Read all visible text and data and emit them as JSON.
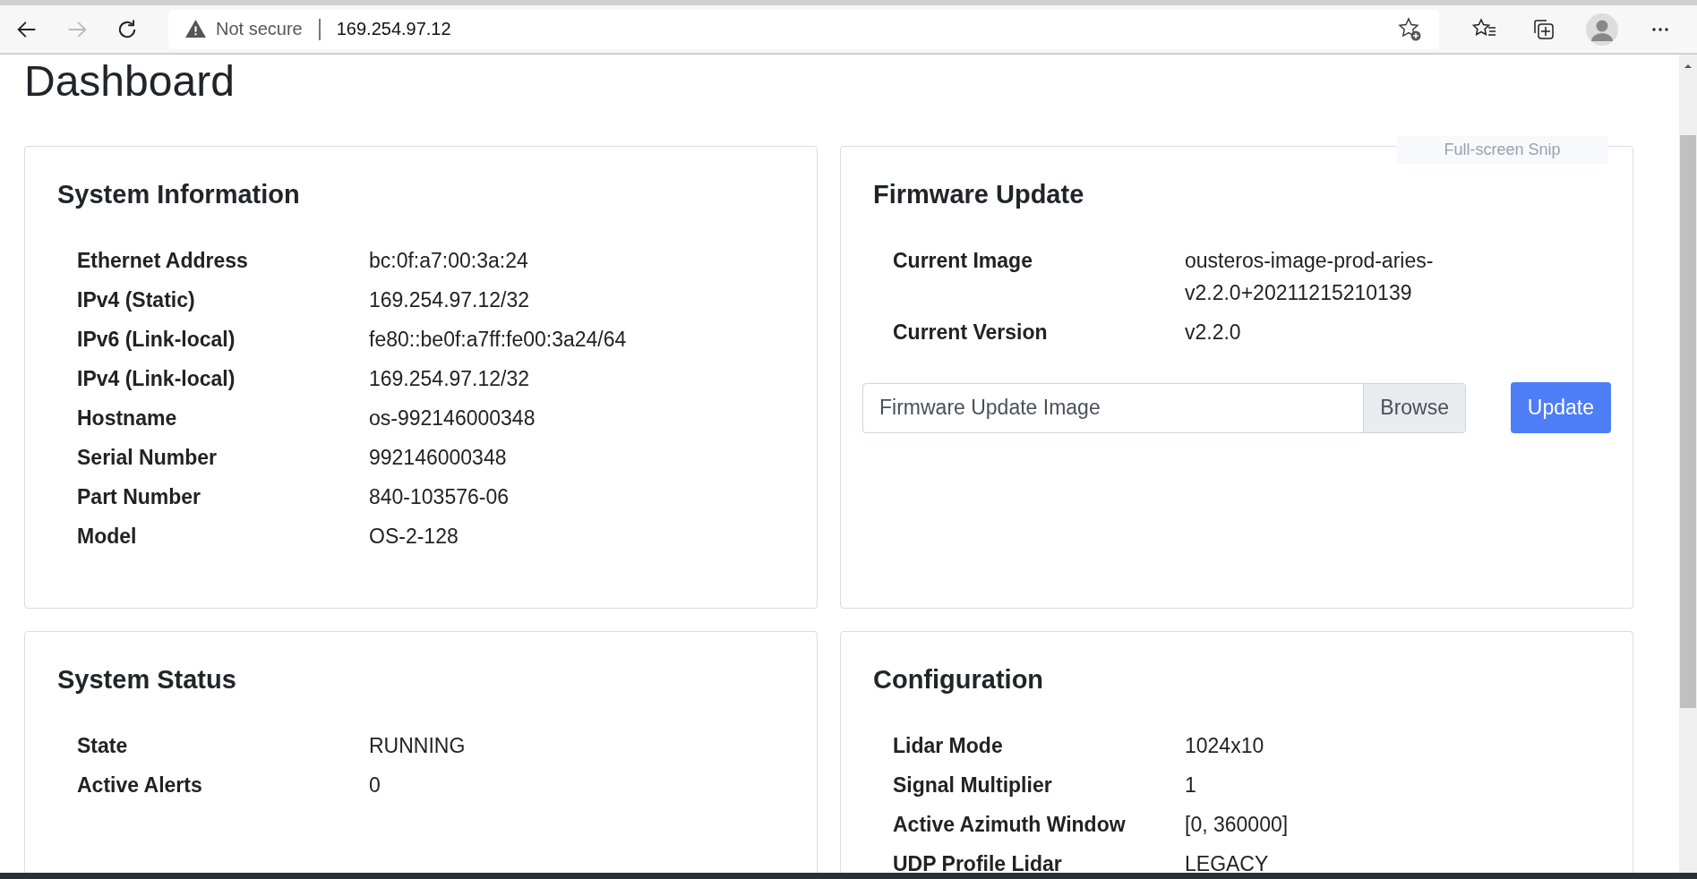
{
  "browser": {
    "forward_disabled": true,
    "security_label": "Not secure",
    "url": "169.254.97.12"
  },
  "page": {
    "title": "Dashboard"
  },
  "overlay_tooltip": "Full-screen Snip",
  "cards": [
    {
      "kind": "info",
      "title": "System Information",
      "rows": [
        {
          "label": "Ethernet Address",
          "value": "bc:0f:a7:00:3a:24"
        },
        {
          "label": "IPv4 (Static)",
          "value": "169.254.97.12/32"
        },
        {
          "label": "IPv6 (Link-local)",
          "value": "fe80::be0f:a7ff:fe00:3a24/64"
        },
        {
          "label": "IPv4 (Link-local)",
          "value": "169.254.97.12/32"
        },
        {
          "label": "Hostname",
          "value": "os-992146000348"
        },
        {
          "label": "Serial Number",
          "value": "992146000348"
        },
        {
          "label": "Part Number",
          "value": "840-103576-06"
        },
        {
          "label": "Model",
          "value": "OS-2-128"
        }
      ]
    },
    {
      "kind": "firmware",
      "title": "Firmware Update",
      "rows": [
        {
          "label": "Current Image",
          "value": "ousteros-image-prod-aries-v2.2.0+20211215210139"
        },
        {
          "label": "Current Version",
          "value": "v2.2.0"
        }
      ],
      "file_placeholder": "Firmware Update Image",
      "browse_label": "Browse",
      "update_label": "Update"
    },
    {
      "kind": "info",
      "title": "System Status",
      "rows": [
        {
          "label": "State",
          "value": "RUNNING"
        },
        {
          "label": "Active Alerts",
          "value": "0"
        }
      ]
    },
    {
      "kind": "info",
      "title": "Configuration",
      "rows": [
        {
          "label": "Lidar Mode",
          "value": "1024x10"
        },
        {
          "label": "Signal Multiplier",
          "value": "1"
        },
        {
          "label": "Active Azimuth Window",
          "value": "[0, 360000]"
        },
        {
          "label": "UDP Profile Lidar",
          "value": "LEGACY"
        }
      ]
    }
  ]
}
